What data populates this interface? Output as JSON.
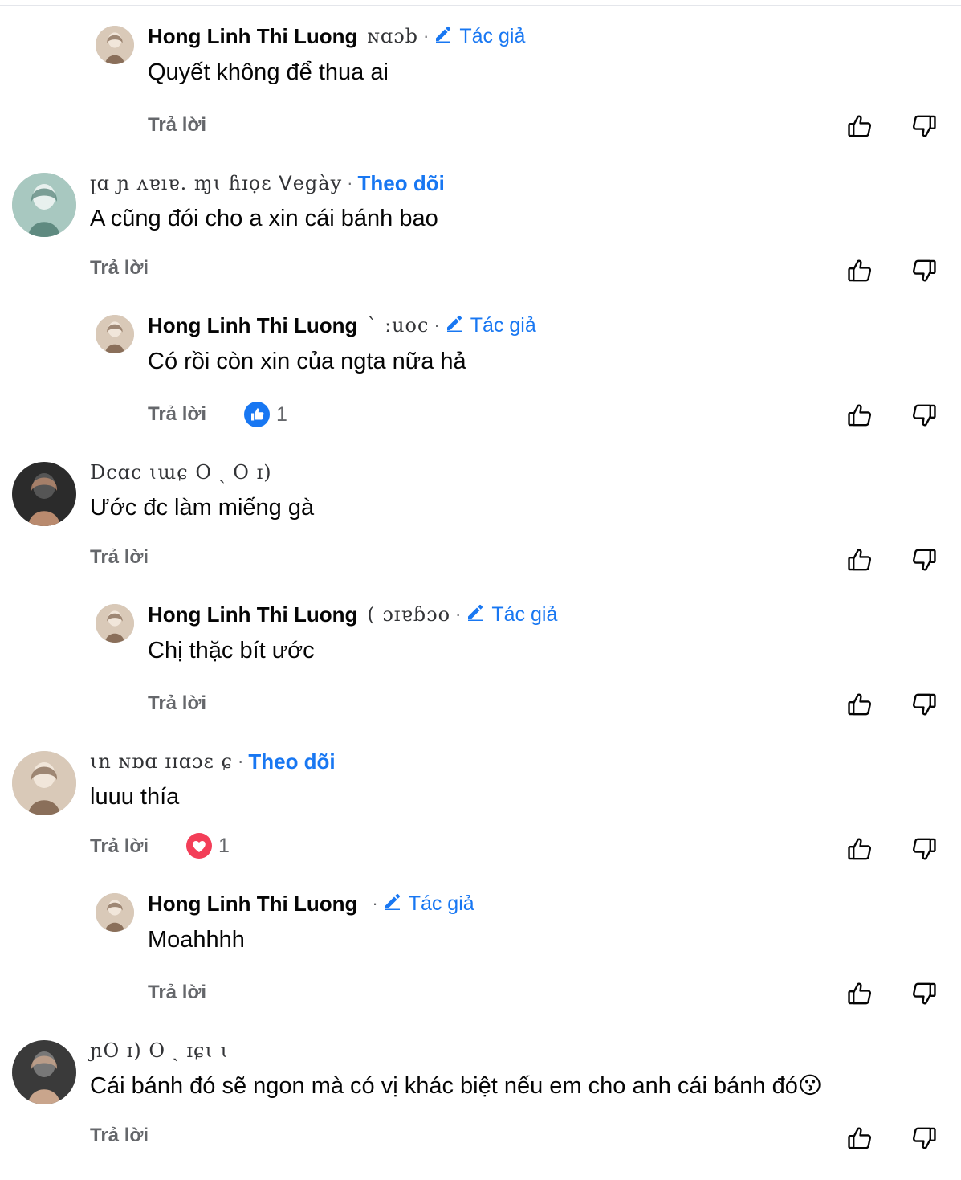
{
  "labels": {
    "reply": "Trả lời",
    "author_badge": "Tác giả",
    "follow": "Theo dõi",
    "dot": "·"
  },
  "colors": {
    "link_blue": "#1877f2",
    "muted": "#65676b",
    "like_blue": "#1877f2",
    "love_red": "#f33e58"
  },
  "comments": [
    {
      "kind": "reply",
      "author": "Hong Linh Thi Luong",
      "time_scribble": "ɴɑɔb",
      "text": "Quyết không để thua ai"
    },
    {
      "kind": "top",
      "author_scribble": "ꞁɑ ɲ ʌɐıɐ. ɱɩ ɦɪọɛ ᐯegày",
      "text": "A cũng đói cho a xin cái bánh bao"
    },
    {
      "kind": "reply",
      "author": "Hong Linh Thi Luong",
      "time_scribble": "ˋ ːuoc",
      "text": "Có rồi còn xin của ngta nữa hả",
      "reaction": {
        "type": "like",
        "count": "1"
      }
    },
    {
      "kind": "top",
      "author_scribble": "Dcɑc ɩɯɕ O ˏ O ɪ)",
      "text": "Ước đc làm miếng gà"
    },
    {
      "kind": "reply",
      "author": "Hong Linh Thi Luong",
      "time_scribble": "( ɔɪɐɓɔo",
      "text": "Chị thặc bít ước"
    },
    {
      "kind": "top",
      "author_scribble": "ɩn ɴɒɑ ɪɪɑɔɛ ɕ",
      "text": "luuu thía",
      "reaction": {
        "type": "love",
        "count": "1"
      }
    },
    {
      "kind": "reply",
      "author": "Hong Linh Thi Luong",
      "time_scribble": "",
      "text": "Moahhhh"
    },
    {
      "kind": "top",
      "author_scribble": "ɲO ɪ) O ˏ ɪɕɩ ɩ",
      "text": "Cái bánh đó sẽ ngon mà có vị khác biệt nếu em cho anh cái bánh đó😗"
    }
  ]
}
